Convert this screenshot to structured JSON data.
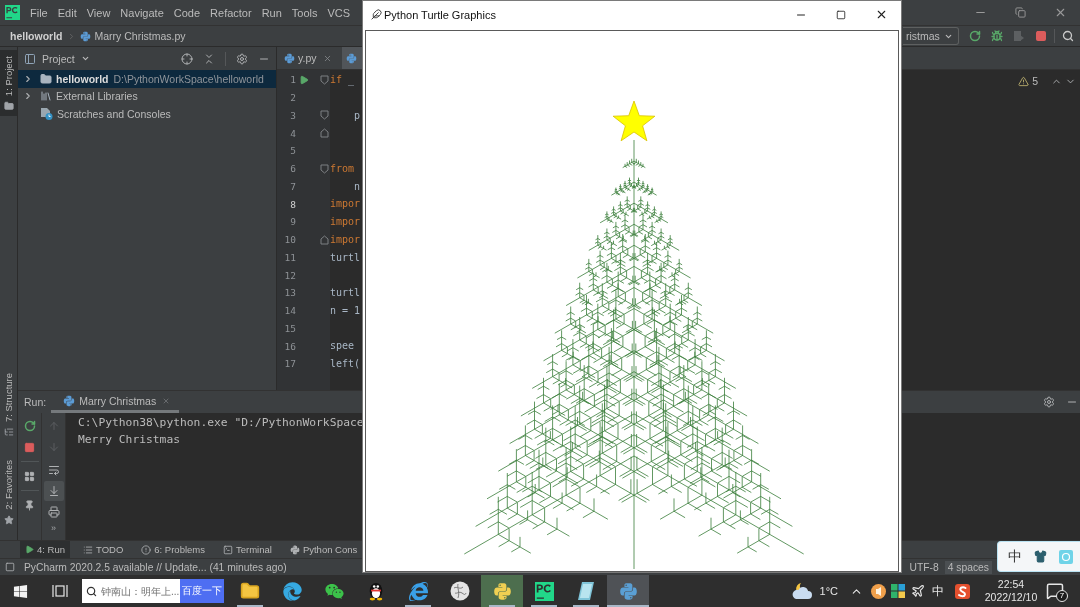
{
  "ide": {
    "menu": [
      "File",
      "Edit",
      "View",
      "Navigate",
      "Code",
      "Refactor",
      "Run",
      "Tools",
      "VCS"
    ],
    "breadcrumb": {
      "project": "helloworld",
      "file": "Marry Christmas.py"
    },
    "toolbar": {
      "run_config": "ristmas",
      "actions": [
        {
          "kind": "rerun",
          "disabled": false
        },
        {
          "kind": "debug",
          "disabled": false
        },
        {
          "kind": "coverage",
          "disabled": true
        },
        {
          "kind": "stop",
          "disabled": false
        },
        {
          "kind": "search",
          "disabled": false
        }
      ]
    },
    "tool_strip": [
      {
        "kind": "project",
        "label": "1: Project",
        "selected": true
      },
      {
        "kind": "structure",
        "label": "7: Structure",
        "selected": false
      },
      {
        "kind": "favorites",
        "label": "2: Favorites",
        "selected": false
      }
    ],
    "project_panel": {
      "title": "Project",
      "tree": [
        {
          "kind": "folder",
          "label": "helloworld",
          "path": "D:\\PythonWorkSpace\\helloworld",
          "selected": true,
          "expandable": true
        },
        {
          "kind": "library",
          "label": "External Libraries",
          "selected": false,
          "expandable": true
        },
        {
          "kind": "scratches",
          "label": "Scratches and Consoles",
          "selected": false,
          "expandable": false
        }
      ]
    },
    "editor": {
      "tabs": [
        {
          "label": "y.py",
          "selected": false
        },
        {
          "selected": true
        }
      ],
      "warnings": "5",
      "lines": [
        {
          "number": "1",
          "run": true,
          "current": false,
          "fold_start": true,
          "fold_end": false,
          "tokens": [
            {
              "text": "if",
              "kind": "keyword"
            },
            {
              "text": " _",
              "kind": "plain"
            }
          ]
        },
        {
          "number": "2",
          "run": false,
          "current": false,
          "fold_start": false,
          "fold_end": false
        },
        {
          "number": "3",
          "run": false,
          "current": false,
          "fold_start": true,
          "fold_end": false,
          "tokens": [
            {
              "text": "    p",
              "kind": "plain"
            }
          ]
        },
        {
          "number": "4",
          "run": false,
          "current": false,
          "fold_start": false,
          "fold_end": true
        },
        {
          "number": "5",
          "run": false,
          "current": false,
          "fold_start": false,
          "fold_end": false
        },
        {
          "number": "6",
          "run": false,
          "current": false,
          "fold_start": true,
          "fold_end": false,
          "tokens": [
            {
              "text": "from",
              "kind": "keyword"
            }
          ]
        },
        {
          "number": "7",
          "run": false,
          "current": false,
          "fold_start": false,
          "fold_end": false,
          "tokens": [
            {
              "text": "    n",
              "kind": "plain"
            }
          ]
        },
        {
          "number": "8",
          "run": false,
          "current": true,
          "fold_start": false,
          "fold_end": false,
          "tokens": [
            {
              "text": "impor",
              "kind": "keyword"
            }
          ]
        },
        {
          "number": "9",
          "run": false,
          "current": false,
          "fold_start": false,
          "fold_end": false,
          "tokens": [
            {
              "text": "impor",
              "kind": "keyword"
            }
          ]
        },
        {
          "number": "10",
          "run": false,
          "current": false,
          "fold_start": false,
          "fold_end": true,
          "tokens": [
            {
              "text": "impor",
              "kind": "keyword"
            }
          ]
        },
        {
          "number": "11",
          "run": false,
          "current": false,
          "fold_start": false,
          "fold_end": false,
          "tokens": [
            {
              "text": "turtl",
              "kind": "plain"
            }
          ]
        },
        {
          "number": "12",
          "run": false,
          "current": false,
          "fold_start": false,
          "fold_end": false
        },
        {
          "number": "13",
          "run": false,
          "current": false,
          "fold_start": false,
          "fold_end": false,
          "tokens": [
            {
              "text": "turtl",
              "kind": "plain"
            }
          ]
        },
        {
          "number": "14",
          "run": false,
          "current": false,
          "fold_start": false,
          "fold_end": false,
          "tokens": [
            {
              "text": "n = 1",
              "kind": "plain"
            }
          ]
        },
        {
          "number": "15",
          "run": false,
          "current": false,
          "fold_start": false,
          "fold_end": false
        },
        {
          "number": "16",
          "run": false,
          "current": false,
          "fold_start": false,
          "fold_end": false,
          "tokens": [
            {
              "text": "spee",
              "kind": "plain"
            }
          ]
        },
        {
          "number": "17",
          "run": false,
          "current": false,
          "fold_start": false,
          "fold_end": false,
          "tokens": [
            {
              "text": "left(",
              "kind": "plain"
            }
          ]
        }
      ]
    },
    "run_panel": {
      "title": "Run:",
      "tab": "Marry Christmas",
      "tools": [
        {
          "kind": "up",
          "disabled": true,
          "on": false
        },
        {
          "kind": "down",
          "disabled": true,
          "on": false
        },
        {
          "kind": "wrap",
          "disabled": false,
          "on": false
        },
        {
          "kind": "scroll-end",
          "disabled": false,
          "on": true
        },
        {
          "kind": "print",
          "disabled": false,
          "on": false
        }
      ],
      "more": "»",
      "console": [
        "C:\\Python38\\python.exe \"D:/PythonWorkSpace",
        "Merry Christmas"
      ]
    },
    "tool_tabs": [
      {
        "kind": "run",
        "label": "4: Run",
        "selected": true
      },
      {
        "kind": "todo",
        "label": "TODO",
        "selected": false
      },
      {
        "kind": "problems",
        "label": "6: Problems",
        "selected": false
      },
      {
        "kind": "terminal",
        "label": "Terminal",
        "selected": false
      },
      {
        "kind": "console",
        "label": "Python Cons",
        "selected": false
      }
    ],
    "status": {
      "message": "PyCharm 2020.2.5 available // Update... (41 minutes ago)",
      "encoding": "UTF-8",
      "indent": "4 spaces"
    }
  },
  "turtle_window": {
    "title": "Python Turtle Graphics"
  },
  "ime_bar": {
    "mode": "中"
  },
  "taskbar": {
    "search": {
      "placeholder": "钟南山：明年上...",
      "button": "百度一下"
    },
    "apps": [
      {
        "kind": "explorer",
        "running": true,
        "selected": false,
        "highlighted": false
      },
      {
        "kind": "edge",
        "running": false,
        "selected": false,
        "highlighted": false
      },
      {
        "kind": "wechat",
        "running": false,
        "selected": false,
        "highlighted": false
      },
      {
        "kind": "qq",
        "running": false,
        "selected": false,
        "highlighted": false
      },
      {
        "kind": "ie",
        "running": true,
        "selected": false,
        "highlighted": false
      },
      {
        "kind": "globe",
        "running": false,
        "selected": false,
        "highlighted": false
      },
      {
        "kind": "python-tool",
        "running": true,
        "selected": false,
        "highlighted": true
      },
      {
        "kind": "pycharm",
        "running": true,
        "selected": false,
        "highlighted": false
      },
      {
        "kind": "notebook",
        "running": true,
        "selected": false,
        "highlighted": false
      },
      {
        "kind": "turtle",
        "running": true,
        "selected": true,
        "highlighted": false
      }
    ],
    "weather": "1°C",
    "input_mode": "中",
    "time": "22:54",
    "date": "2022/12/10",
    "notifications": "7"
  }
}
